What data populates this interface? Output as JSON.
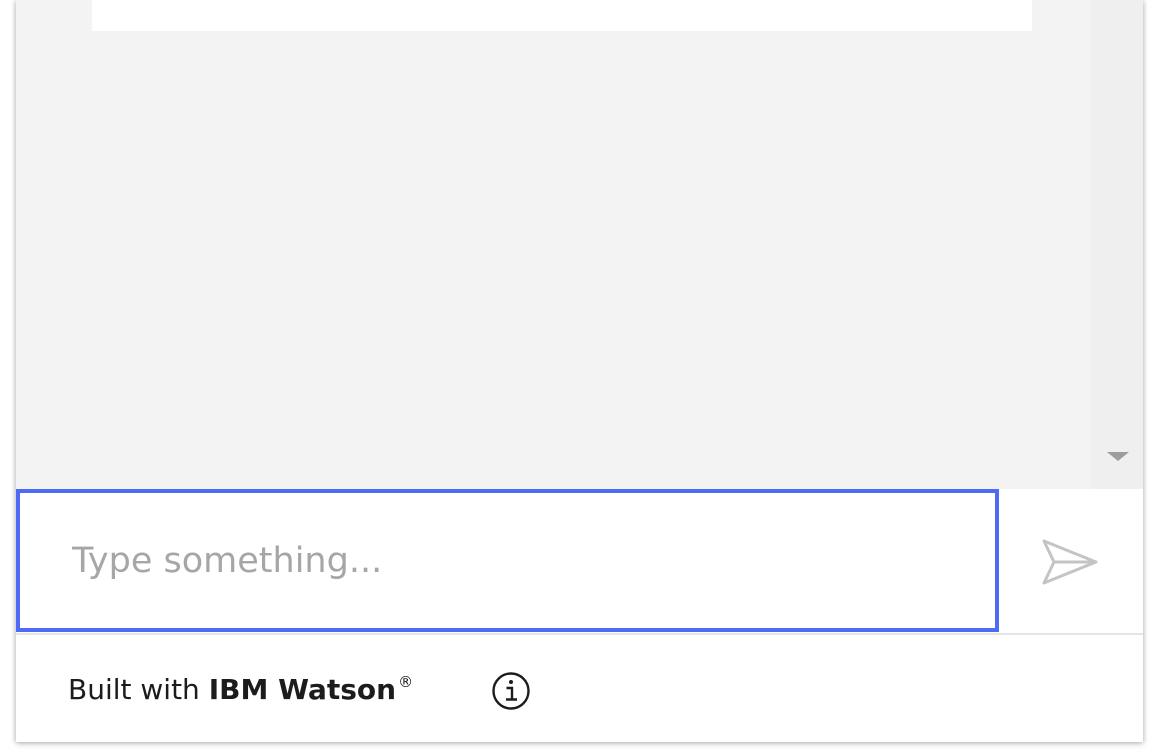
{
  "composer": {
    "input_value": "",
    "placeholder": "Type something..."
  },
  "footer": {
    "built_with_prefix": "Built with",
    "brand": "IBM Watson",
    "registered_mark": "®"
  },
  "icons": {
    "send": "send-icon",
    "info": "info-icon",
    "scroll_down": "scroll-down-arrow-icon"
  },
  "colors": {
    "input_focus_border": "#4f6bf5",
    "message_area_background": "#f3f3f3",
    "placeholder_text": "#a6a6a6",
    "footer_text": "#1c1c1c",
    "send_icon": "#c4c4c4"
  }
}
